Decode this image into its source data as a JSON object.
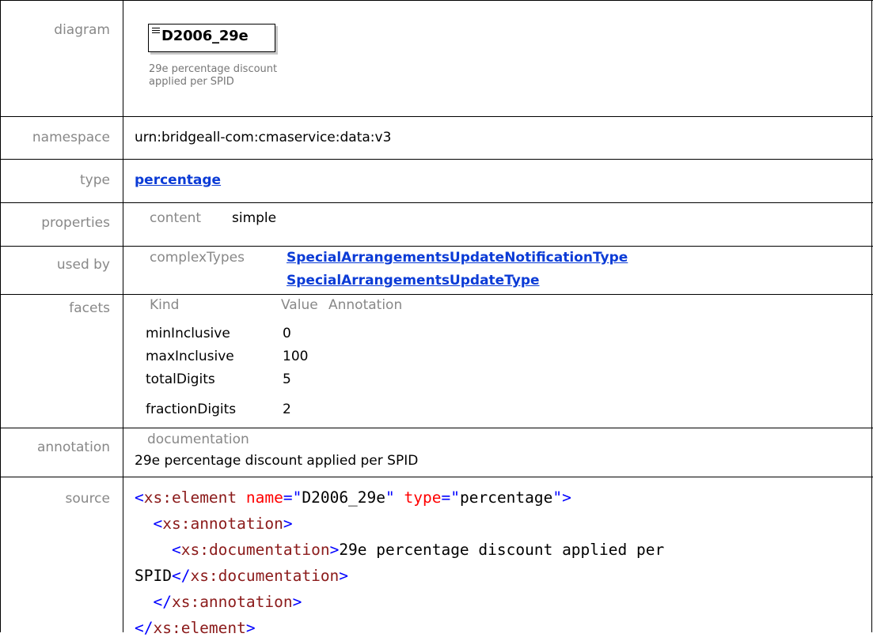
{
  "labels": {
    "diagram": "diagram",
    "namespace": "namespace",
    "type": "type",
    "properties": "properties",
    "used_by": "used by",
    "facets": "facets",
    "annotation": "annotation",
    "source": "source"
  },
  "diagram": {
    "element_name": "D2006_29e",
    "doc_line1": "29e percentage discount",
    "doc_line2": "applied per SPID"
  },
  "namespace": "urn:bridgeall-com:cmaservice:data:v3",
  "type_link": "percentage",
  "properties": {
    "key": "content",
    "value": "simple"
  },
  "used_by": {
    "kind": "complexTypes",
    "links": [
      "SpecialArrangementsUpdateNotificationType",
      "SpecialArrangementsUpdateType"
    ]
  },
  "facets": {
    "headers": [
      "Kind",
      "Value",
      "Annotation"
    ],
    "rows": [
      {
        "kind": "minInclusive",
        "value": "0"
      },
      {
        "kind": "maxInclusive",
        "value": "100"
      },
      {
        "kind": "totalDigits",
        "value": "5"
      },
      {
        "kind": "fractionDigits",
        "value": "2"
      }
    ]
  },
  "annotation": {
    "label": "documentation",
    "text": "29e percentage discount applied per SPID"
  },
  "source": {
    "l1_open": "<",
    "l1_tag": "xs:element",
    "l1_attr1": "name",
    "l1_eq1": "=\"",
    "l1_val1": "D2006_29e",
    "l1_q1": "\"",
    "l1_attr2": "type",
    "l1_eq2": "=\"",
    "l1_val2": "percentage",
    "l1_close": "\">",
    "l2_open": "<",
    "l2_tag": "xs:annotation",
    "l2_close": ">",
    "l3_open": "<",
    "l3_tag": "xs:documentation",
    "l3_close": ">",
    "l3_text": "29e percentage discount applied per",
    "l4_text": "SPID",
    "l4_open": "</",
    "l4_tag": "xs:documentation",
    "l4_close": ">",
    "l5_open": "</",
    "l5_tag": "xs:annotation",
    "l5_close": ">",
    "l6_open": "</",
    "l6_tag": "xs:element",
    "l6_close": ">"
  }
}
